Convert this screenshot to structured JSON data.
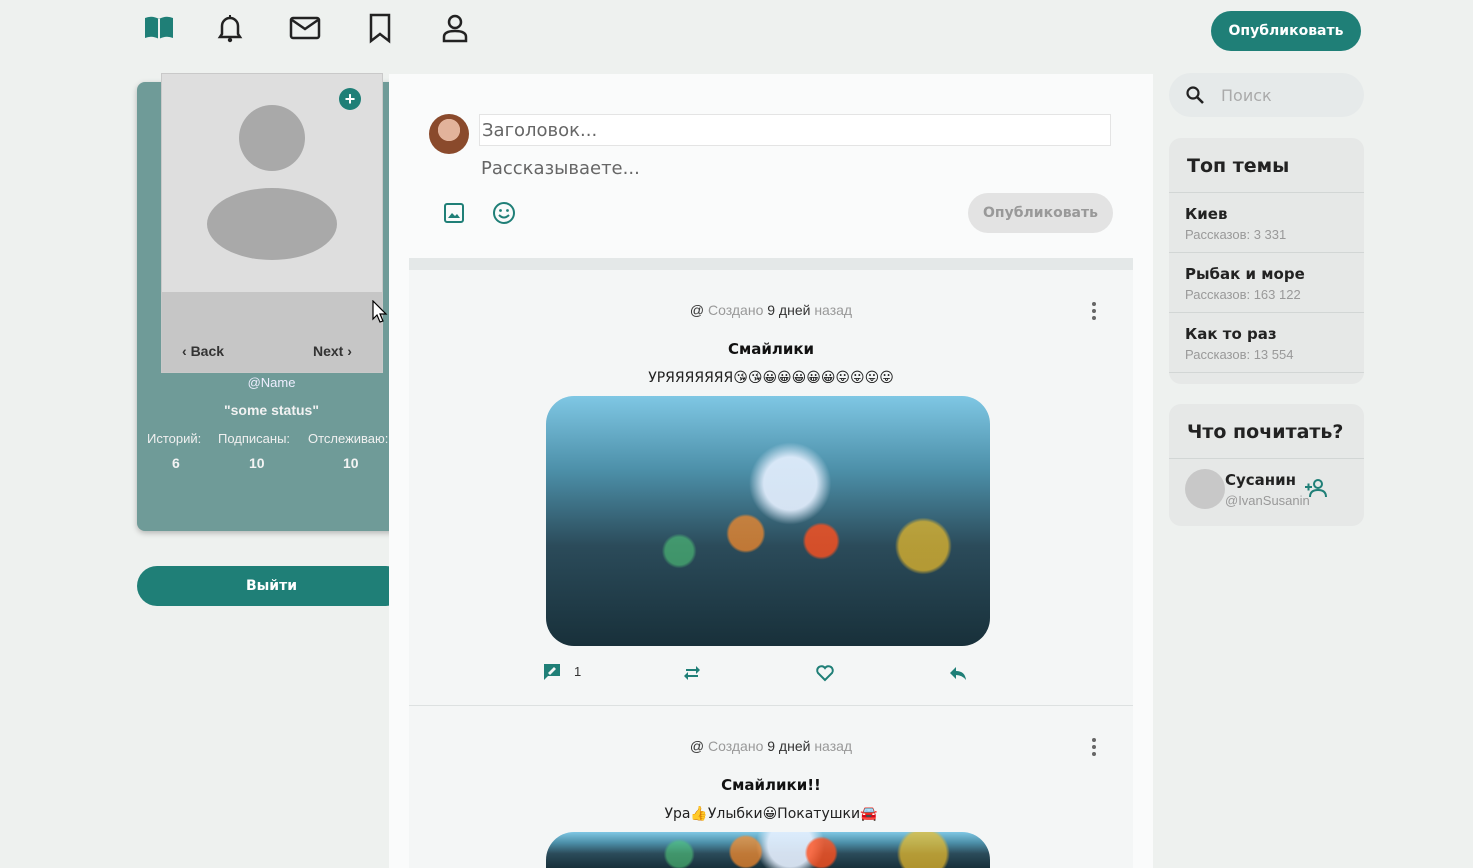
{
  "nav": {
    "icons": [
      "book-icon",
      "bell-icon",
      "mail-icon",
      "bookmark-icon",
      "user-icon"
    ],
    "publish_label": "Опубликовать"
  },
  "profile": {
    "back_label": "Back",
    "next_label": "Next",
    "username": "@Name",
    "status": "\"some status\"",
    "stats": [
      {
        "label": "Историй:",
        "value": "6"
      },
      {
        "label": "Подписаны:",
        "value": "10"
      },
      {
        "label": "Отслеживаю:",
        "value": "10"
      }
    ],
    "logout_label": "Выйти"
  },
  "composer": {
    "title_placeholder": "Заголовок...",
    "text_placeholder": "Рассказываете...",
    "publish_label": "Опубликовать"
  },
  "posts": [
    {
      "meta_at": "@",
      "meta_created": "Создано",
      "meta_num": "9 дней",
      "meta_ago": "назад",
      "title": "Смайлики",
      "text": "УРЯЯЯЯЯЯЯ😘😘😀😀😀😀😀😛😛😛😛",
      "comments": "1"
    },
    {
      "meta_at": "@",
      "meta_created": "Создано",
      "meta_num": "9 дней",
      "meta_ago": "назад",
      "title": "Смайлики!!",
      "text": "Ура👍Улыбки😀Покатушки🚘"
    }
  ],
  "search": {
    "placeholder": "Поиск"
  },
  "top_topics": {
    "title": "Топ темы",
    "items": [
      {
        "name": "Киев",
        "count": "Рассказов: 3 331"
      },
      {
        "name": "Рыбак и море",
        "count": "Рассказов: 163 122"
      },
      {
        "name": "Как то раз",
        "count": "Рассказов: 13 554"
      }
    ]
  },
  "suggest": {
    "title": "Что почитать?",
    "user_name": "Сусанин",
    "user_handle": "@IvanSusanin"
  },
  "colors": {
    "accent": "#1f7f77",
    "card": "#6f9b98"
  }
}
